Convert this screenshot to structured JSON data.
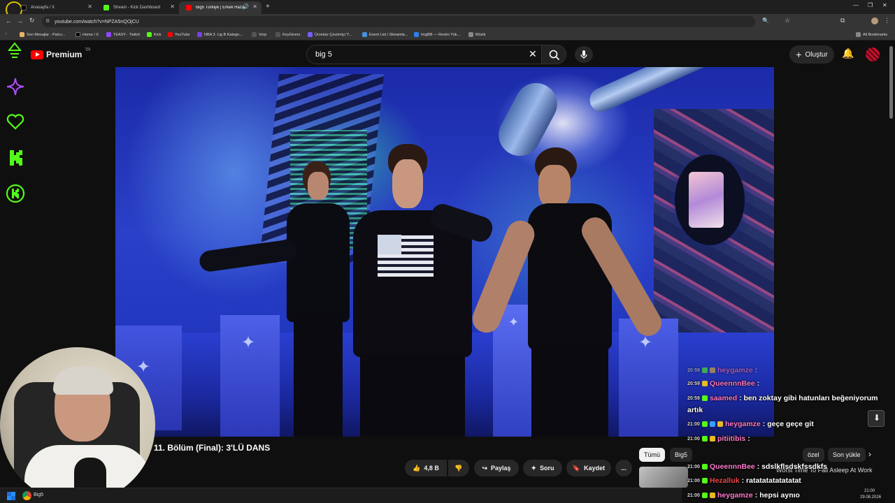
{
  "browser": {
    "tabs": [
      {
        "label": "Anasayfa / X",
        "color": "#1d1d1d"
      },
      {
        "label": "Stream - Kick Dashboard",
        "color": "#53fc18"
      },
      {
        "label": "Big5 Türkiye | Erkek Hazırlı",
        "color": "#ff0000"
      }
    ],
    "new_tab": "+",
    "url": "youtube.com/watch?v=NPZA5nQOjCU",
    "bookmarks": [
      "Son Mesajlar - Patıcı...",
      "Home / X",
      "TEASY - Twitch",
      "Kick",
      "YouTube",
      "NBA 3. Lig B Katego...",
      "Vorp",
      "KeyGivers",
      "Ücretsiz Çevrimiçi Y...",
      "Event List / Streamla...",
      "ImgBB — Resim Yük...",
      "Müzik"
    ],
    "all_bookmarks": "All Bookmarks"
  },
  "youtube": {
    "logo": "Premium",
    "region": "TR",
    "search_value": "big 5",
    "create_label": "Oluştur"
  },
  "video": {
    "title": "11. Bölüm (Final): 3'LÜ DANS",
    "like_count": "4,8 B",
    "share_label": "Paylaş",
    "ask_label": "Soru",
    "save_label": "Kaydet",
    "more_label": "..."
  },
  "chips": [
    "Tümü",
    "Big5",
    "özel",
    "Son yükle"
  ],
  "chat": [
    {
      "time": "20:59",
      "user": "heygamze",
      "text": ":",
      "color": "#ff7acb"
    },
    {
      "time": "20:59",
      "user": "QueennnBee",
      "text": ":",
      "color": "#ff7acb"
    },
    {
      "time": "20:59",
      "user": "saamed",
      "text": ": ben zoktay gibi hatunları beğeniyorum",
      "color": "#ff7acb"
    },
    {
      "time": "",
      "user": "",
      "text": "artık",
      "color": "#ffffff"
    },
    {
      "time": "21:00",
      "user": "heygamze",
      "text": ": geçe geçe git",
      "color": "#ff7acb"
    },
    {
      "time": "21:00",
      "user": "pitiitibis",
      "text": ":",
      "color": "#ff7acb"
    },
    {
      "time": "21:00",
      "user": "QueennnBee",
      "text": ": sdslkflsdskfssdkfs",
      "color": "#ff7acb"
    },
    {
      "time": "21:00",
      "user": "Hezalluk",
      "text": ": ratatatatatatatat",
      "color": "#e84a4a"
    },
    {
      "time": "21:00",
      "user": "heygamze",
      "text": ": hepsi aynıo",
      "color": "#ff7acb"
    }
  ],
  "recommend_text": "Worst Time To Fall Asleep At Work",
  "taskbar": {
    "app": "Big5",
    "time": "21:00",
    "date": "29.08.2026"
  },
  "colors": {
    "kick_green": "#53fc18",
    "yt_red": "#ff0000",
    "accent_purple": "#b04cff"
  }
}
